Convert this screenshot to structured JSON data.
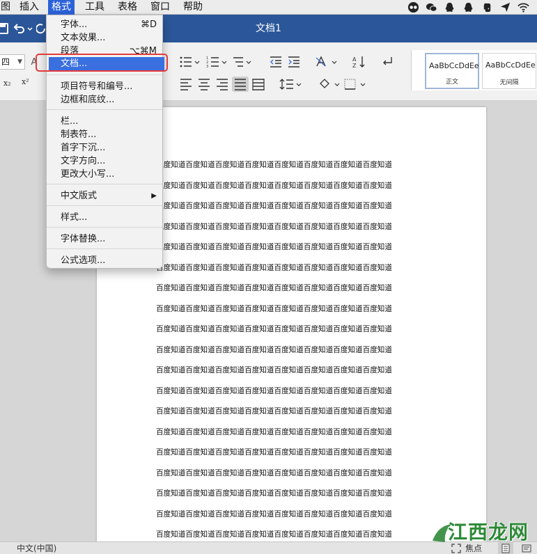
{
  "menubar": {
    "items": [
      "图",
      "插入",
      "格式",
      "工具",
      "表格",
      "窗口",
      "帮助"
    ],
    "active_index": 2
  },
  "window": {
    "title": "文档1"
  },
  "ribbon": {
    "font_size_value": "四",
    "subscript": "x₂",
    "superscript": "x²",
    "styles": [
      {
        "sample": "AaBbCcDdEe",
        "name": "正文",
        "selected": true
      },
      {
        "sample": "AaBbCcDdEe",
        "name": "无间隔",
        "selected": false
      }
    ]
  },
  "format_menu": {
    "items": [
      {
        "label": "字体...",
        "shortcut": "⌘D"
      },
      {
        "label": "文本效果..."
      },
      {
        "label": "段落",
        "shortcut": "⌥⌘M"
      },
      {
        "label": "文档...",
        "highlighted": true
      },
      {
        "label": "项目符号和编号..."
      },
      {
        "label": "边框和底纹..."
      },
      {
        "label": "栏..."
      },
      {
        "label": "制表符..."
      },
      {
        "label": "首字下沉..."
      },
      {
        "label": "文字方向..."
      },
      {
        "label": "更改大小写..."
      },
      {
        "label": "中文版式",
        "submenu_arrow": "▶"
      },
      {
        "label": "样式..."
      },
      {
        "label": "字体替换..."
      },
      {
        "label": "公式选项..."
      }
    ]
  },
  "document": {
    "line_text": "百度知道百度知道百度知道百度知道百度知道百度知道百度知道百度知道"
  },
  "statusbar": {
    "language": "中文(中国)",
    "focus": "焦点"
  },
  "watermark": {
    "text": "江西龙网"
  },
  "colors": {
    "titlebar": "#2b579a",
    "menu_highlight": "#3a6fe0",
    "annotation_box": "#e53a3a",
    "watermark": "#2e8a38"
  }
}
